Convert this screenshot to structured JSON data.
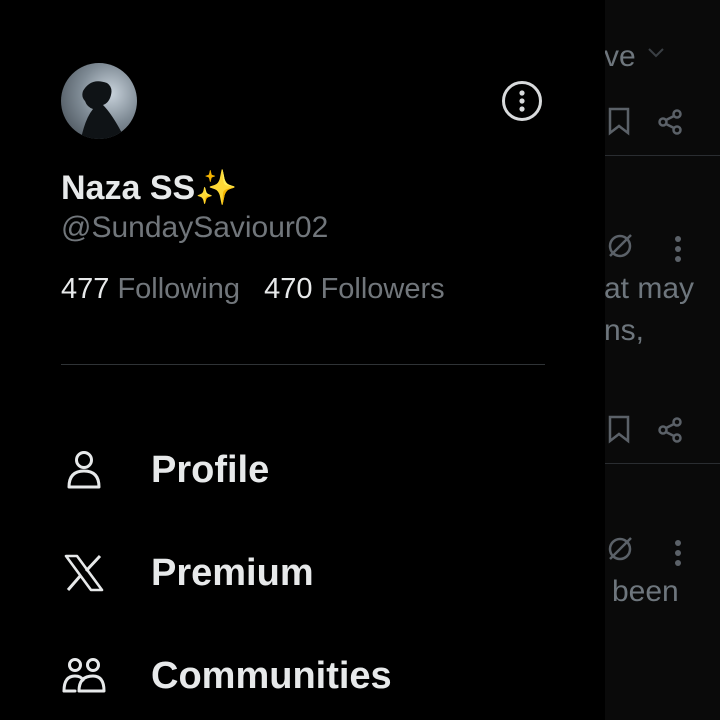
{
  "feed": {
    "snippet_top": "ve",
    "snippet_line1": "at may",
    "snippet_line2": "ns,",
    "snippet_bottom": "been"
  },
  "profile": {
    "name": "Naza SS✨",
    "handle": "@SundaySaviour02",
    "following_count": "477",
    "following_label": "Following",
    "followers_count": "470",
    "followers_label": "Followers"
  },
  "menu": {
    "items": [
      {
        "label": "Profile",
        "icon": "person-icon"
      },
      {
        "label": "Premium",
        "icon": "x-logo-icon"
      },
      {
        "label": "Communities",
        "icon": "communities-icon"
      }
    ]
  },
  "colors": {
    "background": "#000000",
    "text_primary": "#e7e9ea",
    "text_secondary": "#71767b",
    "divider": "#2f3336"
  }
}
